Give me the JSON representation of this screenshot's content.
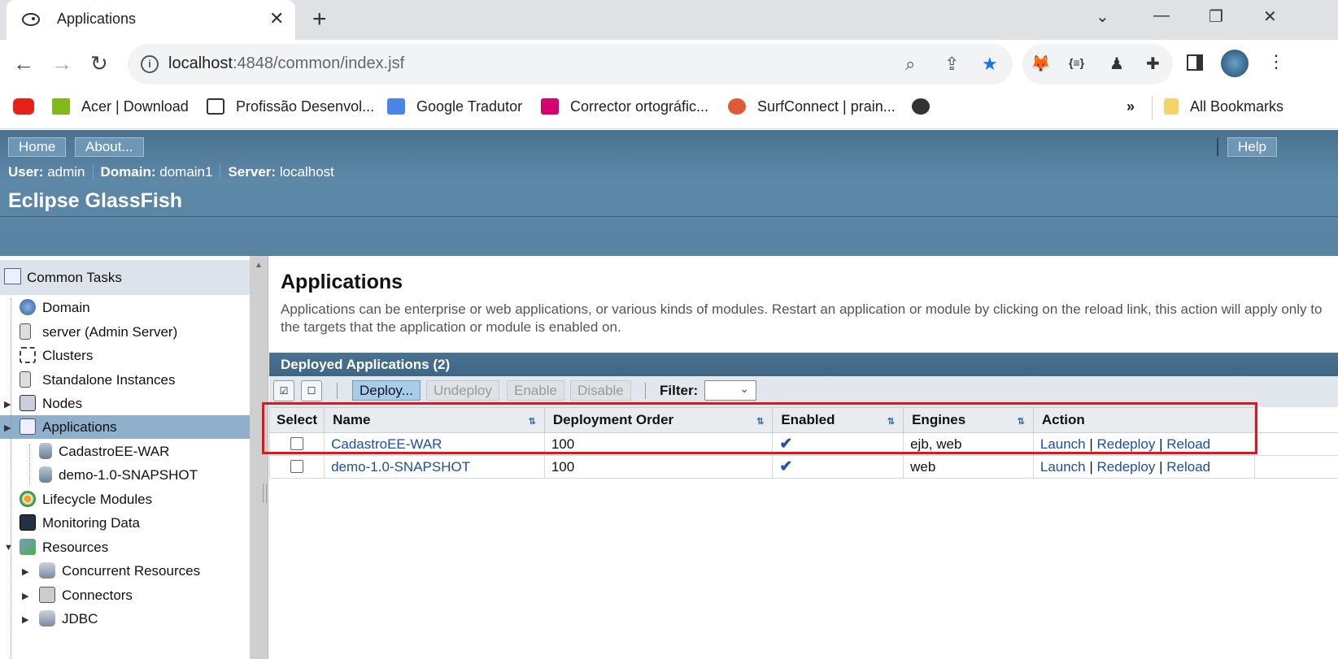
{
  "browser": {
    "tab_title": "Applications",
    "url_host": "localhost",
    "url_rest": ":4848/common/index.jsf",
    "bookmarks": [
      "Acer | Download",
      "Profissão Desenvol...",
      "Google Tradutor",
      "Corrector ortográfic...",
      "SurfConnect | prain..."
    ],
    "overflow": "»",
    "all_bookmarks": "All Bookmarks"
  },
  "header": {
    "home": "Home",
    "about": "About...",
    "help": "Help",
    "user_label": "User:",
    "user": "admin",
    "domain_label": "Domain:",
    "domain": "domain1",
    "server_label": "Server:",
    "server": "localhost",
    "brand": "Eclipse GlassFish"
  },
  "sidebar": {
    "title": "Common Tasks",
    "items": [
      "Domain",
      "server (Admin Server)",
      "Clusters",
      "Standalone Instances",
      "Nodes",
      "Applications",
      "CadastroEE-WAR",
      "demo-1.0-SNAPSHOT",
      "Lifecycle Modules",
      "Monitoring Data",
      "Resources",
      "Concurrent Resources",
      "Connectors",
      "JDBC"
    ]
  },
  "main": {
    "title": "Applications",
    "description": "Applications can be enterprise or web applications, or various kinds of modules. Restart an application or module by clicking on the reload link, this action will apply only to the targets that the application or module is enabled on.",
    "table_title": "Deployed Applications (2)",
    "buttons": {
      "deploy": "Deploy...",
      "undeploy": "Undeploy",
      "enable": "Enable",
      "disable": "Disable"
    },
    "filter_label": "Filter:",
    "columns": [
      "Select",
      "Name",
      "Deployment Order",
      "Enabled",
      "Engines",
      "Action"
    ],
    "rows": [
      {
        "name": "CadastroEE-WAR",
        "order": "100",
        "enabled": "✔",
        "engines": "ejb, web",
        "launch": "Launch",
        "redeploy": "Redeploy",
        "reload": "Reload",
        "sep": "|"
      },
      {
        "name": "demo-1.0-SNAPSHOT",
        "order": "100",
        "enabled": "✔",
        "engines": "web",
        "launch": "Launch",
        "redeploy": "Redeploy",
        "reload": "Reload",
        "sep": "|"
      }
    ]
  },
  "colors": {
    "highlight": "#e3141c",
    "header": "#5e88a8",
    "link": "#1d4fa0"
  }
}
